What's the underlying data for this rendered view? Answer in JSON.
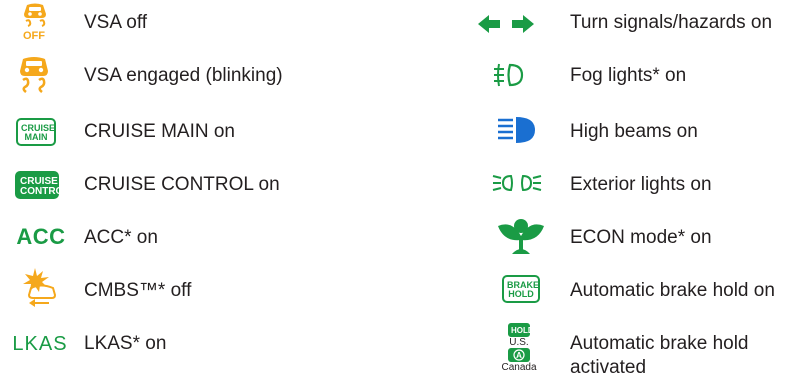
{
  "colors": {
    "green": "#1a9b45",
    "amber": "#f5a81c",
    "blue": "#1a6fd1",
    "text": "#231f20"
  },
  "left_items": [
    {
      "icon": "vsa-off-icon",
      "icon_text": "OFF",
      "label": "VSA off"
    },
    {
      "icon": "vsa-engaged-icon",
      "label": "VSA engaged (blinking)"
    },
    {
      "icon": "cruise-main-icon",
      "icon_line1": "CRUISE",
      "icon_line2": "MAIN",
      "label": "CRUISE MAIN on"
    },
    {
      "icon": "cruise-control-icon",
      "icon_line1": "CRUISE",
      "icon_line2": "CONTROL",
      "label": "CRUISE CONTROL on"
    },
    {
      "icon": "acc-icon",
      "icon_text": "ACC",
      "label": "ACC* on"
    },
    {
      "icon": "cmbs-off-icon",
      "label": "CMBS™* off"
    },
    {
      "icon": "lkas-icon",
      "icon_text": "LKAS",
      "label": "LKAS* on"
    }
  ],
  "right_items": [
    {
      "icon": "turn-signals-icon",
      "label": "Turn signals/hazards on"
    },
    {
      "icon": "fog-lights-icon",
      "label": "Fog lights* on"
    },
    {
      "icon": "high-beams-icon",
      "label": "High beams on"
    },
    {
      "icon": "exterior-lights-icon",
      "label": "Exterior lights on"
    },
    {
      "icon": "econ-mode-icon",
      "label": "ECON mode* on"
    },
    {
      "icon": "brake-hold-icon",
      "icon_line1": "BRAKE",
      "icon_line2": "HOLD",
      "label": "Automatic brake hold on"
    },
    {
      "icon": "brake-hold-activated-icon",
      "icon_top": "HOLD",
      "icon_us": "U.S.",
      "icon_canada": "Canada",
      "label": "Automatic brake hold activated"
    }
  ]
}
